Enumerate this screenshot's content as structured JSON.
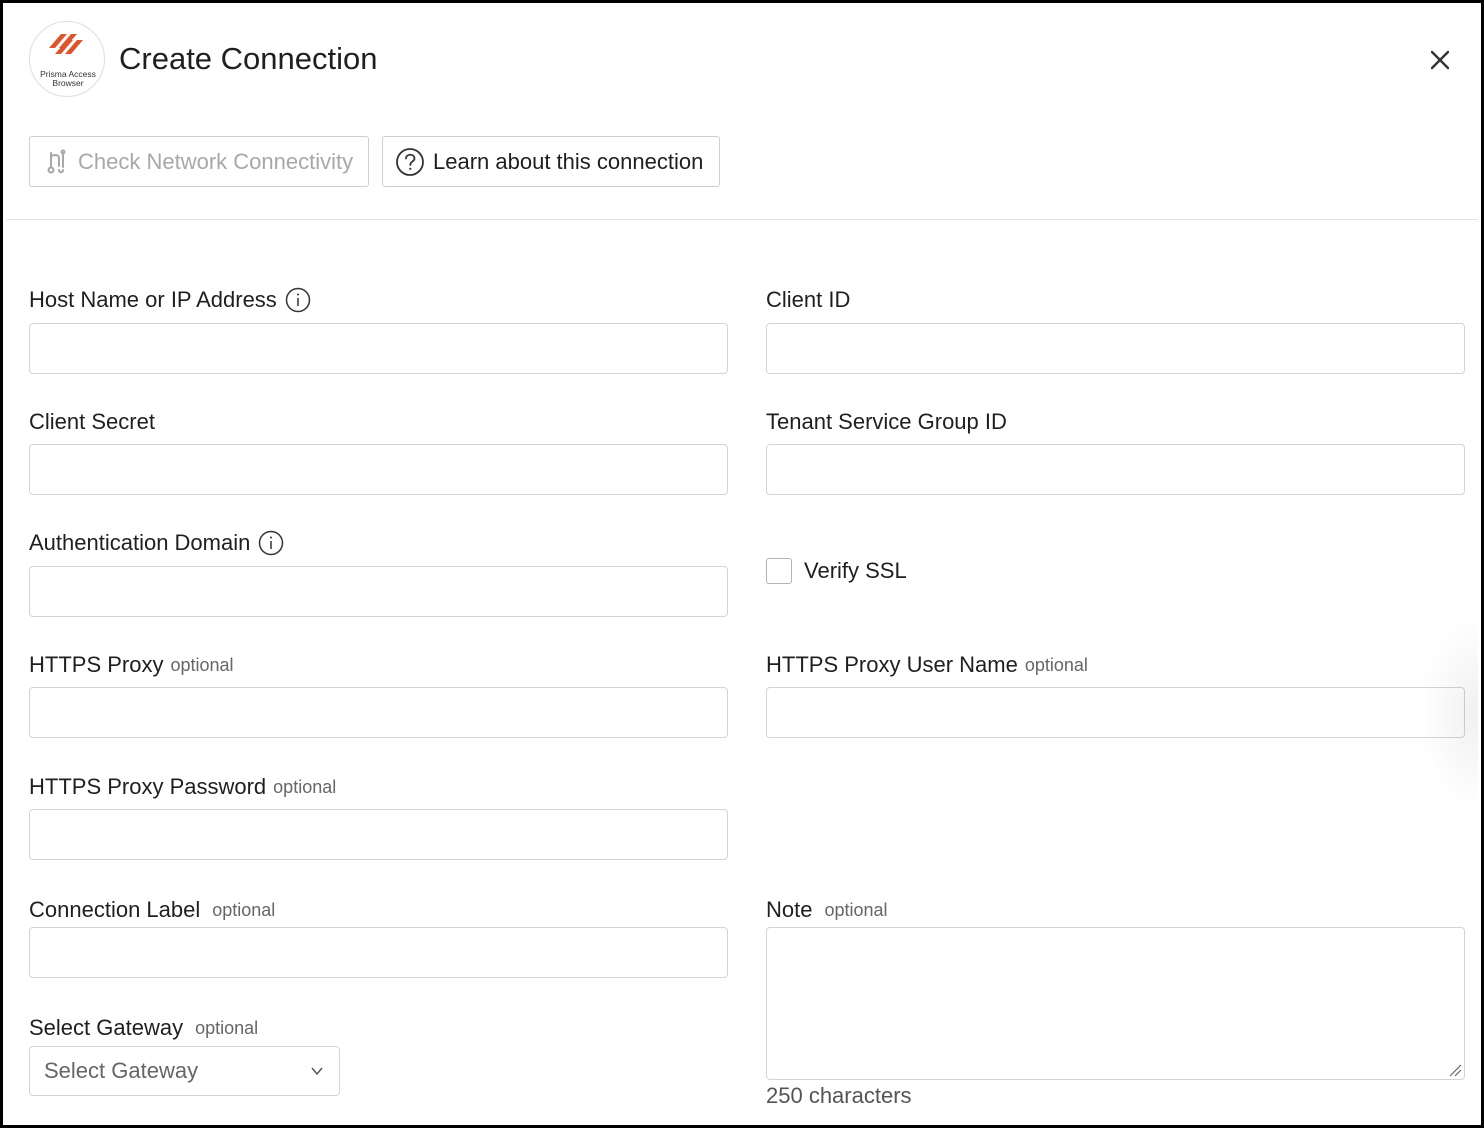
{
  "header": {
    "logo_line1": "Prisma Access",
    "logo_line2": "Browser",
    "title": "Create Connection",
    "close_icon": "close-icon"
  },
  "toolbar": {
    "check_label": "Check Network Connectivity",
    "check_icon": "network-connectivity-icon",
    "learn_label": "Learn about this connection",
    "learn_icon": "question-circle-icon"
  },
  "form": {
    "host": {
      "label": "Host Name or IP Address",
      "value": ""
    },
    "client_id": {
      "label": "Client ID",
      "value": ""
    },
    "client_secret": {
      "label": "Client Secret",
      "value": ""
    },
    "tenant": {
      "label": "Tenant Service Group ID",
      "value": ""
    },
    "auth_domain": {
      "label": "Authentication Domain",
      "value": ""
    },
    "verify_ssl": {
      "label": "Verify SSL",
      "checked": false
    },
    "https_proxy": {
      "label": "HTTPS Proxy",
      "optional": "optional",
      "value": ""
    },
    "https_proxy_user": {
      "label": "HTTPS Proxy User Name",
      "optional": "optional",
      "value": ""
    },
    "https_proxy_password": {
      "label": "HTTPS Proxy Password",
      "optional": "optional",
      "value": ""
    },
    "connection_label": {
      "label": "Connection Label",
      "optional": "optional",
      "value": ""
    },
    "note": {
      "label": "Note",
      "optional": "optional",
      "value": "",
      "counter": "250 characters"
    },
    "gateway": {
      "label": "Select Gateway",
      "optional": "optional",
      "selected": "Select Gateway"
    }
  },
  "colors": {
    "brand": "#e0542c",
    "disabled_text": "#a8a8a8",
    "border": "#d4d4d4"
  }
}
